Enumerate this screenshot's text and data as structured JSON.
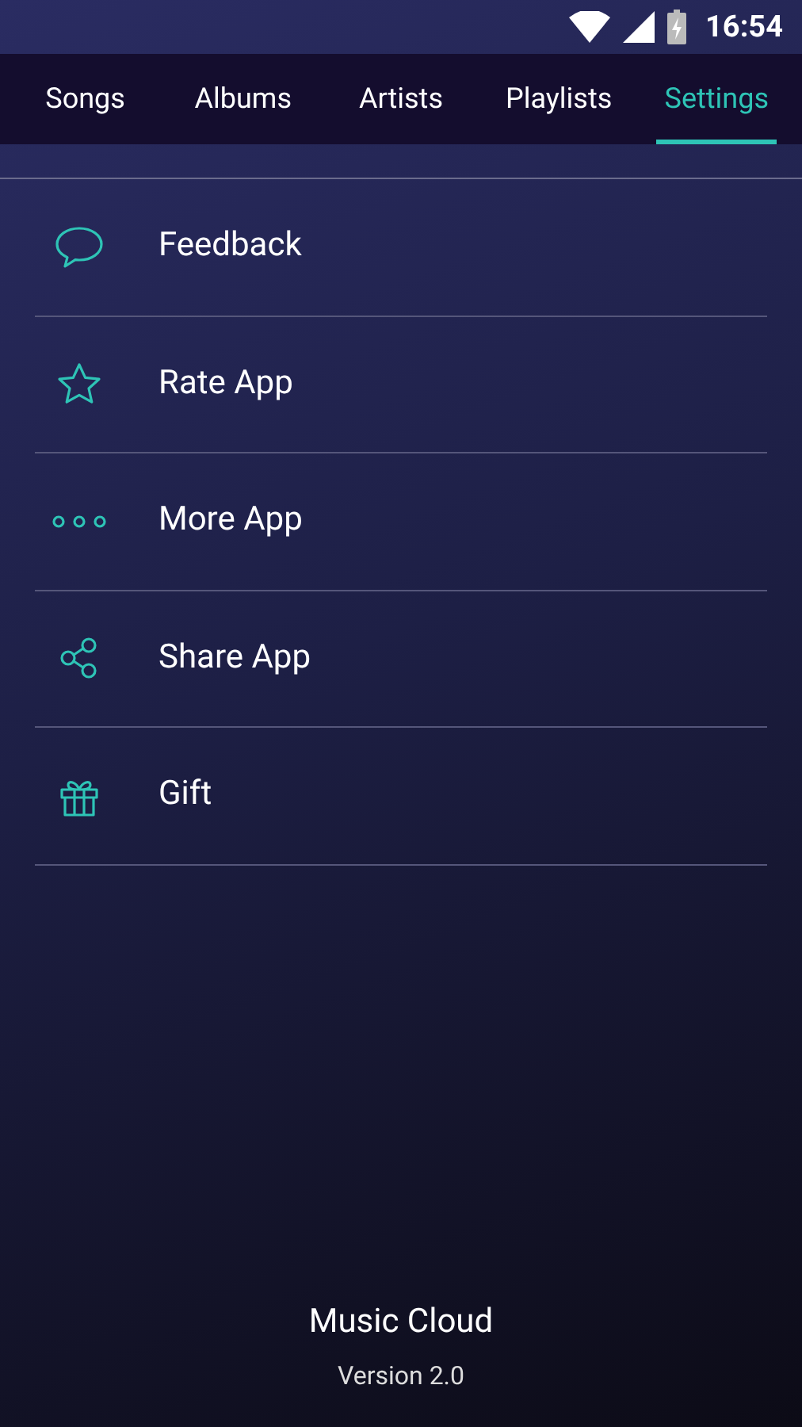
{
  "status_bar": {
    "time": "16:54"
  },
  "tabs": [
    {
      "label": "Songs",
      "selected": false
    },
    {
      "label": "Albums",
      "selected": false
    },
    {
      "label": "Artists",
      "selected": false
    },
    {
      "label": "Playlists",
      "selected": false
    },
    {
      "label": "Settings",
      "selected": true
    }
  ],
  "settings": [
    {
      "kind": "feedback",
      "label": "Feedback"
    },
    {
      "kind": "rate",
      "label": "Rate App"
    },
    {
      "kind": "more",
      "label": "More App"
    },
    {
      "kind": "share",
      "label": "Share App"
    },
    {
      "kind": "gift",
      "label": "Gift"
    }
  ],
  "footer": {
    "app_name": "Music Cloud",
    "version": "Version 2.0"
  }
}
